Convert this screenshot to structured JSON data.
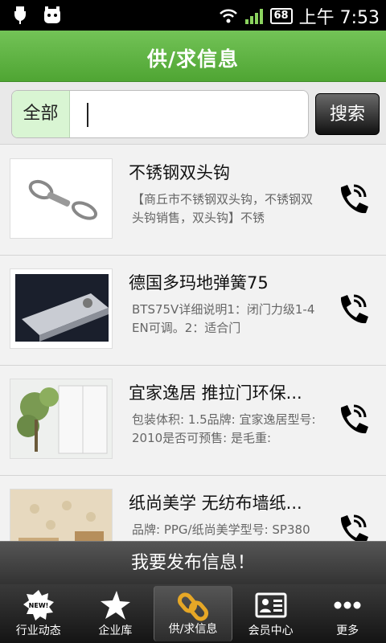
{
  "status_bar": {
    "time": "上午 7:53",
    "battery": "68"
  },
  "header": {
    "title": "供/求信息"
  },
  "search": {
    "category": "全部",
    "value": "",
    "placeholder": "",
    "button_label": "搜索"
  },
  "items": [
    {
      "title": "不锈钢双头钩",
      "desc": "【商丘市不锈钢双头钩，不锈钢双头钩销售，双头钩】不锈",
      "image": "double-hook-image"
    },
    {
      "title": "德国多玛地弹簧75",
      "desc": "BTS75V详细说明1：闭门力级1-4EN可调。2：适合门",
      "image": "floor-spring-image"
    },
    {
      "title": "宜家逸居 推拉门环保...",
      "desc": "包装体积: 1.5品牌: 宜家逸居型号: 2010是否可预售: 是毛重:",
      "image": "plant-room-image"
    },
    {
      "title": "纸尚美学 无纺布墙纸...",
      "desc": "品牌: PPG/纸尚美学型号: SP380",
      "image": "wallpaper-room-image"
    }
  ],
  "publish_label": "我要发布信息！",
  "nav": [
    {
      "label": "行业动态",
      "icon": "new-badge-icon",
      "badge": "NEW!"
    },
    {
      "label": "企业库",
      "icon": "star-icon"
    },
    {
      "label": "供/求信息",
      "icon": "chain-link-icon"
    },
    {
      "label": "会员中心",
      "icon": "member-card-icon"
    },
    {
      "label": "更多",
      "icon": "more-dots-icon"
    }
  ],
  "colors": {
    "header_green": "#5cb33f",
    "search_category_bg": "#d9f5d3"
  }
}
